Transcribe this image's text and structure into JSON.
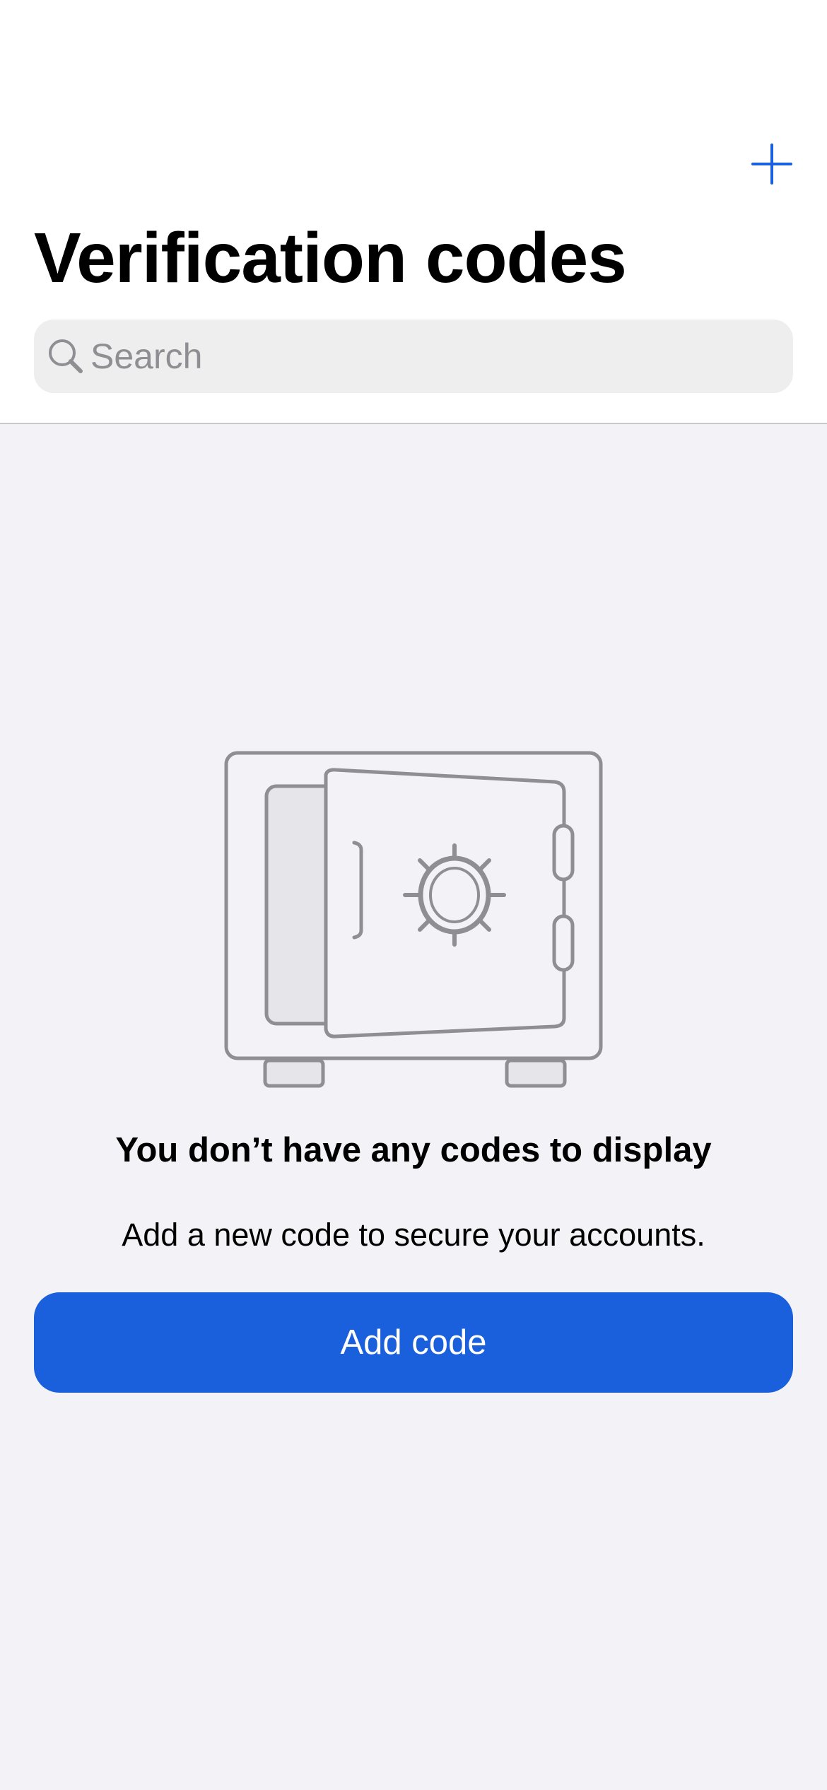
{
  "header": {
    "title": "Verification codes",
    "add_icon": "plus-icon",
    "accent_color": "#1a5fdc"
  },
  "search": {
    "placeholder": "Search",
    "value": "",
    "icon": "search-icon"
  },
  "empty_state": {
    "illustration": "safe-icon",
    "title": "You don’t have any codes to display",
    "subtitle": "Add a new code to secure your accounts.",
    "button_label": "Add code"
  }
}
